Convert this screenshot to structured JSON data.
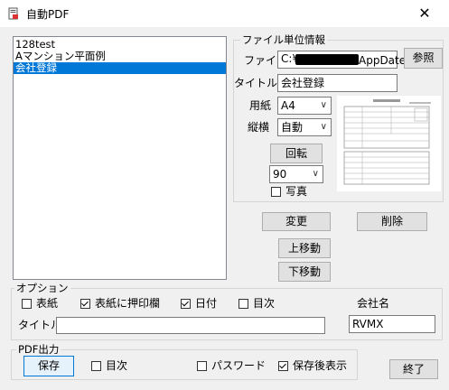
{
  "window": {
    "title": "自動PDF",
    "close_glyph": "✕"
  },
  "list": {
    "items": [
      "128test",
      "Aマンション平面例",
      "会社登録"
    ],
    "selected_index": 2
  },
  "file_info": {
    "group_label": "ファイル単位情報",
    "file_label": "ファイル",
    "file_path_prefix": "C:¥",
    "file_path_suffix": "AppDate",
    "browse_label": "参照",
    "title_label": "タイトル",
    "title_value": "会社登録",
    "paper_label": "用紙",
    "paper_value": "A4",
    "orientation_label": "縦横",
    "orientation_value": "自動",
    "rotate_label": "回転",
    "rotate_value": "90",
    "photo_label": "写真",
    "photo_checked": false
  },
  "actions": {
    "modify": "変更",
    "delete": "削除",
    "move_up": "上移動",
    "move_down": "下移動"
  },
  "options": {
    "group_label": "オプション",
    "cover": {
      "label": "表紙",
      "checked": false
    },
    "cover_stamp": {
      "label": "表紙に押印欄",
      "checked": true
    },
    "date": {
      "label": "日付",
      "checked": true
    },
    "toc": {
      "label": "目次",
      "checked": false
    },
    "company_label": "会社名",
    "company_value": "RVMX",
    "title_label": "タイトル",
    "title_value": ""
  },
  "pdf_output": {
    "group_label": "PDF出力",
    "save_label": "保存",
    "toc": {
      "label": "目次",
      "checked": false
    },
    "password": {
      "label": "パスワード",
      "checked": false
    },
    "show_after_save": {
      "label": "保存後表示",
      "checked": true
    }
  },
  "exit_label": "終了",
  "colors": {
    "selection": "#0078d7",
    "window_bg": "#f0f0f0"
  }
}
